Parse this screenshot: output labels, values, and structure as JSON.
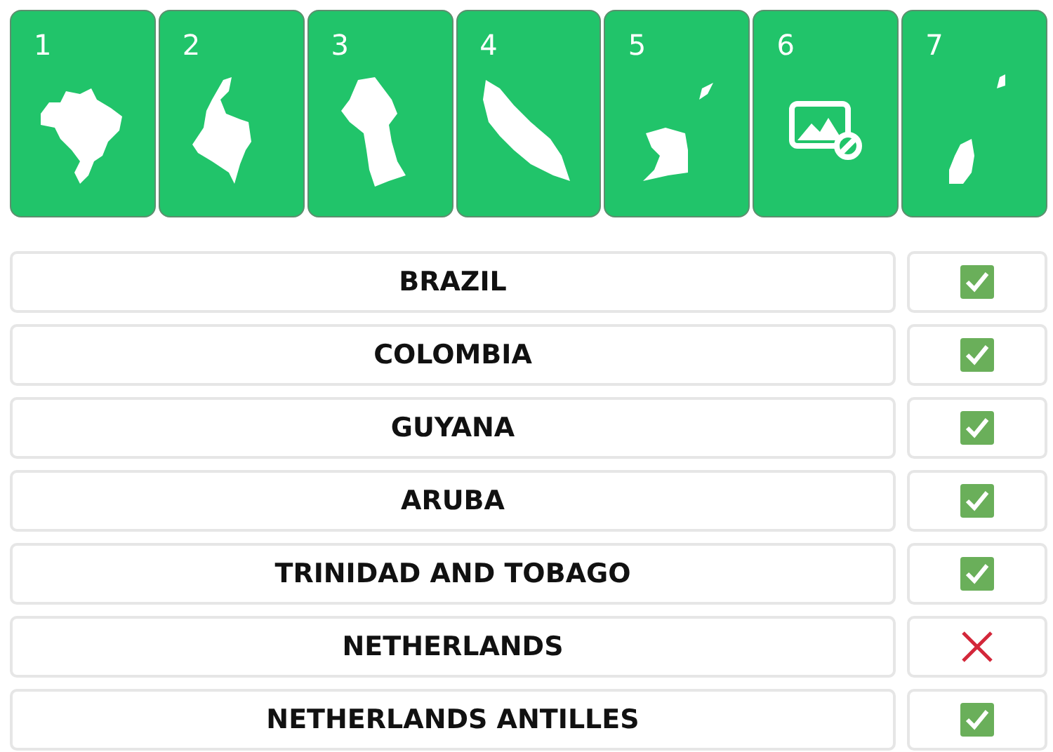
{
  "cards": [
    {
      "number": "1",
      "kind": "silhouette"
    },
    {
      "number": "2",
      "kind": "silhouette"
    },
    {
      "number": "3",
      "kind": "silhouette"
    },
    {
      "number": "4",
      "kind": "silhouette"
    },
    {
      "number": "5",
      "kind": "silhouette"
    },
    {
      "number": "6",
      "kind": "no-image"
    },
    {
      "number": "7",
      "kind": "silhouette"
    }
  ],
  "answers": [
    {
      "country": "BRAZIL",
      "correct": true
    },
    {
      "country": "COLOMBIA",
      "correct": true
    },
    {
      "country": "GUYANA",
      "correct": true
    },
    {
      "country": "ARUBA",
      "correct": true
    },
    {
      "country": "TRINIDAD AND TOBAGO",
      "correct": true
    },
    {
      "country": "NETHERLANDS",
      "correct": false
    },
    {
      "country": "NETHERLANDS ANTILLES",
      "correct": true
    }
  ]
}
